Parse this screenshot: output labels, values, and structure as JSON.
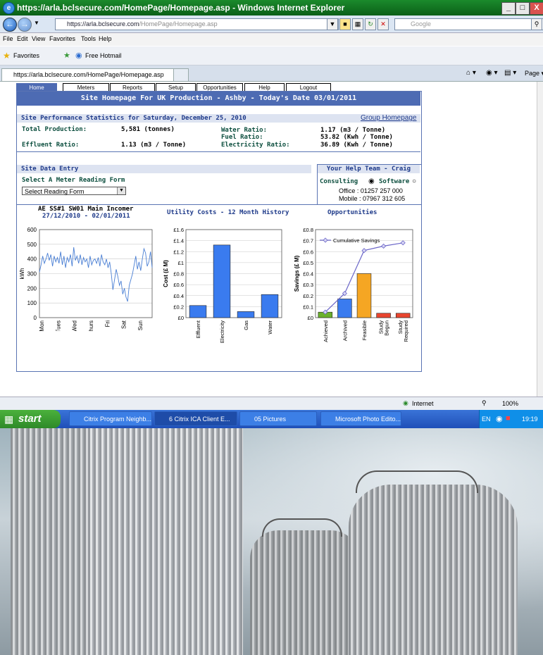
{
  "browser": {
    "title": "https://arla.bclsecure.com/HomePage/Homepage.asp - Windows Internet Explorer",
    "url_host": "https://arla.bclsecure.com",
    "url_path": "/HomePage/Homepage.asp",
    "search_placeholder": "Google",
    "menu": [
      "File",
      "Edit",
      "View",
      "Favorites",
      "Tools",
      "Help"
    ],
    "favorites_label": "Favorites",
    "favorites_link": "Free Hotmail",
    "tab_title": "https://arla.bclsecure.com/HomePage/Homepage.asp",
    "page_menu": "Page ▾",
    "status_zone": "Internet",
    "zoom": "100%"
  },
  "taskbar": {
    "start": "start",
    "items": [
      "Citrix Program Neighb...",
      "6 Citrix ICA Client E...",
      "05 Pictures",
      "Microsoft Photo Edito..."
    ],
    "lang": "EN",
    "clock": "19:19"
  },
  "site": {
    "nav": [
      "Home",
      "Meters",
      "Reports",
      "Setup",
      "Opportunities",
      "Help",
      "Logout"
    ],
    "banner": "Site Homepage For UK Production - Ashby - Today's Date 03/01/2011",
    "stats_header": "Site Performance Statistics for Saturday, December 25, 2010",
    "group_link": "Group Homepage",
    "stats": {
      "total_production_label": "Total Production:",
      "total_production_value": "5,581 (tonnes)",
      "effluent_label": "Effluent Ratio:",
      "effluent_value": "1.13 (m3 / Tonne)",
      "water_label": "Water Ratio:",
      "water_value": "1.17 (m3 / Tonne)",
      "fuel_label": "Fuel Ratio:",
      "fuel_value": "53.82 (Kwh / Tonne)",
      "electricity_label": "Electricity Ratio:",
      "electricity_value": "36.89 (Kwh / Tonne)"
    },
    "data_entry_header": "Site Data Entry",
    "meter_form_label": "Select A Meter Reading Form",
    "meter_form_select": "Select Reading Form",
    "help": {
      "header": "Your Help Team - Craig",
      "consulting": "Consulting",
      "software": "Software",
      "office": "Office : 01257 257 000",
      "mobile": "Mobile : 07967 312 605"
    }
  },
  "chart_titles": {
    "meter_line1": "AE SS#1 SW01 Main Incomer",
    "meter_line2": "27/12/2010 - 02/01/2011",
    "utility": "Utility Costs - 12 Month History",
    "opportunities": "Opportunities"
  },
  "chart_data": [
    {
      "type": "line",
      "title": "AE SS#1 SW01 Main Incomer",
      "subtitle": "27/12/2010 - 02/01/2011",
      "ylabel": "kWh",
      "ylim": [
        0,
        600
      ],
      "yticks": [
        0,
        100,
        200,
        300,
        400,
        500,
        600
      ],
      "categories": [
        "Mon",
        "Tues",
        "Wed",
        "Thurs",
        "Fri",
        "Sat",
        "Sun"
      ],
      "values": [
        310,
        360,
        420,
        370,
        400,
        440,
        390,
        430,
        350,
        420,
        380,
        410,
        370,
        450,
        360,
        420,
        340,
        410,
        380,
        430,
        350,
        480,
        390,
        420,
        370,
        430,
        360,
        410,
        380,
        400,
        340,
        420,
        360,
        390,
        400,
        370,
        410,
        350,
        430,
        380,
        360,
        400,
        340,
        380,
        300,
        190,
        260,
        330,
        280,
        220,
        250,
        160,
        200,
        140,
        110,
        220,
        260,
        300,
        360,
        420,
        330,
        380,
        320,
        400,
        470,
        440,
        350,
        380,
        450,
        340
      ],
      "color": "#4a7fd4",
      "grid": true
    },
    {
      "type": "bar",
      "title": "Utility Costs - 12 Month History",
      "ylabel": "Cost (£ M)",
      "ylim": [
        0,
        1.6
      ],
      "yticks": [
        "£0",
        "£0.2",
        "£0.4",
        "£0.6",
        "£0.8",
        "£1",
        "£1.2",
        "£1.4",
        "£1.6"
      ],
      "categories": [
        "Effluent",
        "Electricity",
        "Gas",
        "Water"
      ],
      "values": [
        0.22,
        1.32,
        0.11,
        0.42
      ],
      "color": "#3a7bef",
      "grid": true
    },
    {
      "type": "bar",
      "title": "Opportunities",
      "ylabel": "Savings (£ M)",
      "ylim": [
        0,
        0.8
      ],
      "yticks": [
        "£0",
        "£0.1",
        "£0.2",
        "£0.3",
        "£0.4",
        "£0.5",
        "£0.6",
        "£0.7",
        "£0.8"
      ],
      "categories": [
        "Achieved",
        "Archived",
        "Feasible",
        "Study Begun",
        "Study Required"
      ],
      "values": [
        0.05,
        0.17,
        0.4,
        0.04,
        0.04
      ],
      "bar_colors": [
        "#6ab02c",
        "#3a7bef",
        "#f5a623",
        "#e8452f",
        "#e8452f"
      ],
      "line": {
        "name": "Cumulative Savings",
        "values": [
          0.05,
          0.22,
          0.61,
          0.65,
          0.68
        ],
        "color": "#6b66c8"
      },
      "legend": "top-left",
      "grid": true
    }
  ]
}
